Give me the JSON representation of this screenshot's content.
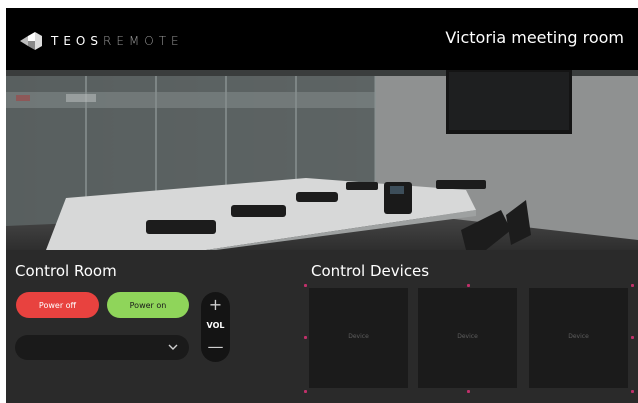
{
  "header": {
    "logo_primary": "TEOS",
    "logo_secondary": "REMOTE",
    "room_title": "Victoria meeting room"
  },
  "control_room": {
    "title": "Control Room",
    "power_off_label": "Power off",
    "power_on_label": "Power on",
    "volume_label": "VOL",
    "volume_up_glyph": "+",
    "volume_down_glyph": "—",
    "source_select_value": ""
  },
  "control_devices": {
    "title": "Control Devices",
    "devices": [
      {
        "label": "Device"
      },
      {
        "label": "Device"
      },
      {
        "label": "Device"
      }
    ]
  },
  "colors": {
    "header_bg": "#000000",
    "panel_bg": "#2a2a2a",
    "power_off": "#e8423f",
    "power_on": "#8fd55a",
    "device_tile": "#1b1b1b",
    "marker": "#c0306a"
  },
  "icons": [
    "teos-logo-icon",
    "chevron-down-icon"
  ]
}
